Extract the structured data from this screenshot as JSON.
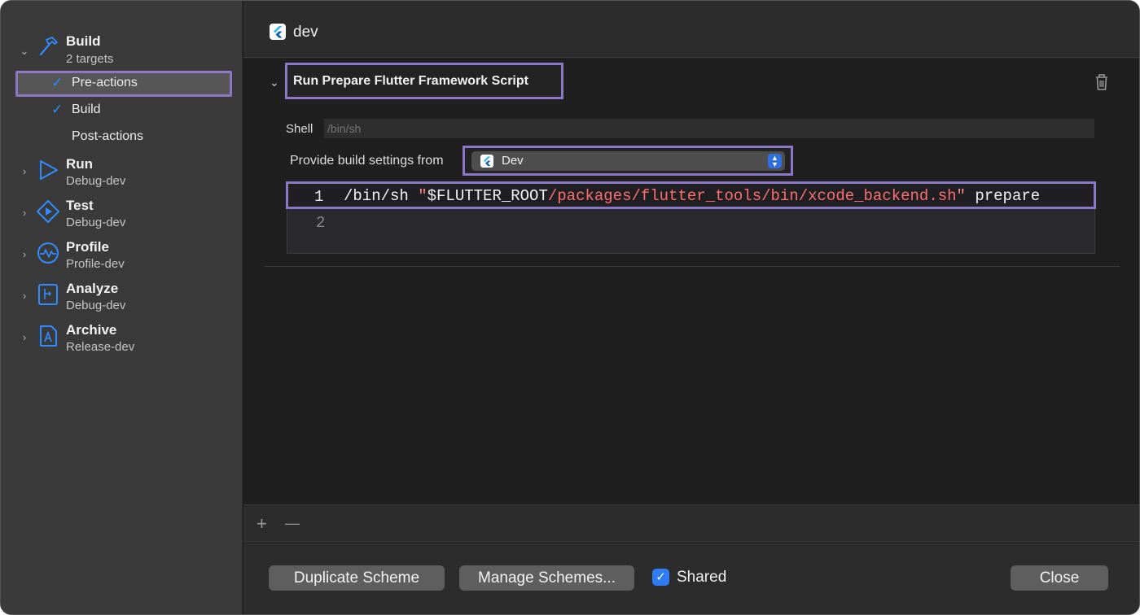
{
  "sidebar": {
    "groups": [
      {
        "name": "Build",
        "sub": "2 targets",
        "icon": "hammer-icon",
        "expanded": true
      },
      {
        "name": "Run",
        "sub": "Debug-dev",
        "icon": "play-icon"
      },
      {
        "name": "Test",
        "sub": "Debug-dev",
        "icon": "test-diamond-icon"
      },
      {
        "name": "Profile",
        "sub": "Profile-dev",
        "icon": "profile-gauge-icon"
      },
      {
        "name": "Analyze",
        "sub": "Debug-dev",
        "icon": "analyze-icon"
      },
      {
        "name": "Archive",
        "sub": "Release-dev",
        "icon": "archive-icon"
      }
    ],
    "build_items": [
      {
        "label": "Pre-actions",
        "checked": true,
        "selected": true
      },
      {
        "label": "Build",
        "checked": true
      },
      {
        "label": "Post-actions",
        "checked": false
      }
    ]
  },
  "header": {
    "title": "dev",
    "icon": "flutter-icon"
  },
  "action": {
    "title": "Run Prepare Flutter Framework Script",
    "shell_label": "Shell",
    "shell_placeholder": "/bin/sh",
    "provide_label": "Provide build settings from",
    "provide_value": "Dev",
    "code_lines": [
      {
        "num": "1",
        "part1": "/bin/sh ",
        "quote_open": "\"",
        "part2": "$FLUTTER_ROOT",
        "part3": "/packages/flutter_tools/bin/xcode_backend.sh",
        "quote_close": "\"",
        "part4": " prepare"
      },
      {
        "num": "2"
      }
    ]
  },
  "controls": {
    "plus": "+",
    "minus": "—"
  },
  "footer": {
    "duplicate": "Duplicate Scheme",
    "manage": "Manage Schemes...",
    "shared": "Shared",
    "shared_checked": true,
    "close": "Close"
  },
  "colors": {
    "accent": "#2f7cf6",
    "highlight_border": "#8a78c6",
    "string": "#ff6e6e"
  }
}
